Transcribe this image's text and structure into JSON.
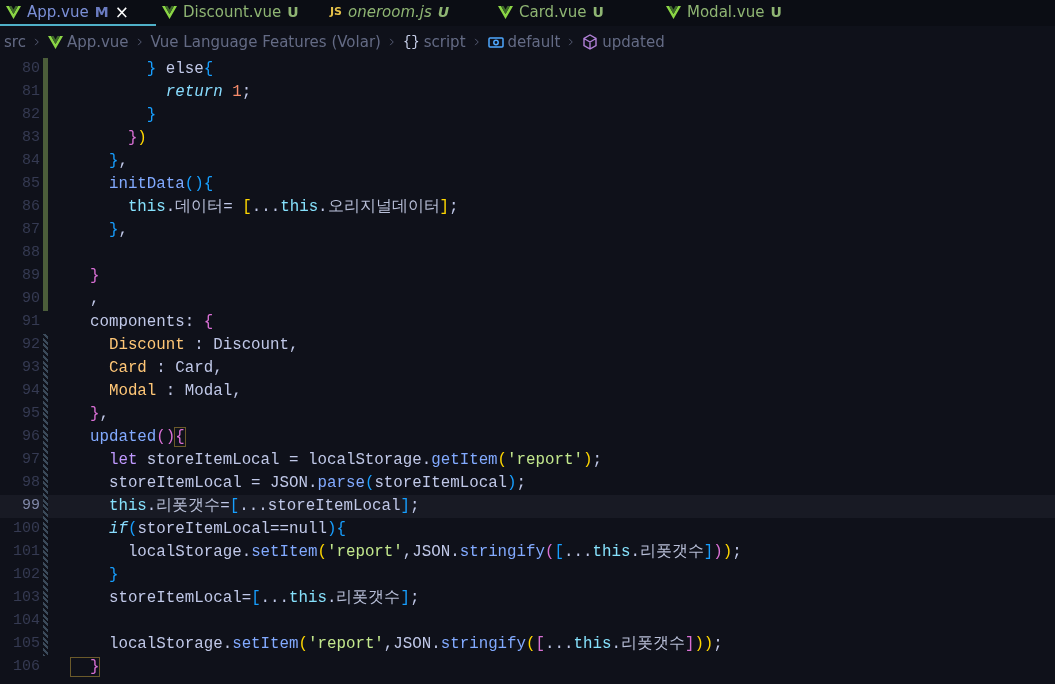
{
  "tabs": [
    {
      "label": "App.vue",
      "kind": "vue",
      "badge": "M",
      "selected": true,
      "italic": false,
      "close": "×"
    },
    {
      "label": "Discount.vue",
      "kind": "vue",
      "badge": "U",
      "selected": false,
      "italic": false
    },
    {
      "label": "oneroom.js",
      "kind": "js",
      "icon_label": "JS",
      "badge": "U",
      "selected": false,
      "italic": true
    },
    {
      "label": "Card.vue",
      "kind": "vue",
      "badge": "U",
      "selected": false,
      "italic": false
    },
    {
      "label": "Modal.vue",
      "kind": "vue",
      "badge": "U",
      "selected": false,
      "italic": false
    }
  ],
  "breadcrumb": [
    {
      "label": "src",
      "kind": "folder"
    },
    {
      "label": "App.vue",
      "kind": "vue"
    },
    {
      "label": "Vue Language Features (Volar)",
      "kind": "text"
    },
    {
      "label": "script",
      "kind": "braces",
      "glyph": "{}"
    },
    {
      "label": "default",
      "kind": "module"
    },
    {
      "label": "updated",
      "kind": "method"
    }
  ],
  "editor": {
    "lines": [
      {
        "number": "80",
        "modified": true,
        "added": false,
        "current": false,
        "tokens": [
          {
            "kind": "b3",
            "text": "        }"
          },
          {
            "kind": "p",
            "text": " else"
          },
          {
            "kind": "b3",
            "text": "{"
          }
        ]
      },
      {
        "number": "81",
        "modified": true,
        "added": false,
        "current": false,
        "tokens": [
          {
            "kind": "k",
            "text": "          return "
          },
          {
            "kind": "n",
            "text": "1"
          },
          {
            "kind": "p",
            "text": ";"
          }
        ]
      },
      {
        "number": "82",
        "modified": true,
        "added": false,
        "current": false,
        "tokens": [
          {
            "kind": "b3",
            "text": "        }"
          }
        ]
      },
      {
        "number": "83",
        "modified": true,
        "added": false,
        "current": false,
        "tokens": [
          {
            "kind": "b2",
            "text": "      }"
          },
          {
            "kind": "b1",
            "text": ")"
          }
        ]
      },
      {
        "number": "84",
        "modified": true,
        "added": false,
        "current": false,
        "tokens": [
          {
            "kind": "b3",
            "text": "    }"
          },
          {
            "kind": "p",
            "text": ","
          }
        ]
      },
      {
        "number": "85",
        "modified": true,
        "added": false,
        "current": false,
        "tokens": [
          {
            "kind": "f",
            "text": "    initData"
          },
          {
            "kind": "b3",
            "text": "(){"
          }
        ]
      },
      {
        "number": "86",
        "modified": true,
        "added": false,
        "current": false,
        "tokens": [
          {
            "kind": "t",
            "text": "      this"
          },
          {
            "kind": "p",
            "text": "."
          },
          {
            "kind": "h",
            "text": "데이터"
          },
          {
            "kind": "p",
            "text": "= "
          },
          {
            "kind": "b1",
            "text": "["
          },
          {
            "kind": "p",
            "text": "..."
          },
          {
            "kind": "t",
            "text": "this"
          },
          {
            "kind": "p",
            "text": "."
          },
          {
            "kind": "h",
            "text": "오리지널데이터"
          },
          {
            "kind": "b1",
            "text": "]"
          },
          {
            "kind": "p",
            "text": ";"
          }
        ]
      },
      {
        "number": "87",
        "modified": true,
        "added": false,
        "current": false,
        "tokens": [
          {
            "kind": "b3",
            "text": "    }"
          },
          {
            "kind": "p",
            "text": ","
          }
        ]
      },
      {
        "number": "88",
        "modified": true,
        "added": false,
        "current": false
      },
      {
        "number": "89",
        "modified": true,
        "added": false,
        "current": false,
        "tokens": [
          {
            "kind": "b2",
            "text": "  }"
          }
        ]
      },
      {
        "number": "90",
        "modified": true,
        "added": false,
        "current": false,
        "tokens": [
          {
            "kind": "p",
            "text": "  ,"
          }
        ]
      },
      {
        "number": "91",
        "modified": false,
        "added": false,
        "current": false,
        "tokens": [
          {
            "kind": "p",
            "text": "  components: "
          },
          {
            "kind": "b2",
            "text": "{"
          }
        ]
      },
      {
        "number": "92",
        "modified": false,
        "added": true,
        "current": false,
        "tokens": [
          {
            "kind": "y",
            "text": "    Discount"
          },
          {
            "kind": "p",
            "text": " : Discount,"
          }
        ]
      },
      {
        "number": "93",
        "modified": false,
        "added": true,
        "current": false,
        "tokens": [
          {
            "kind": "y",
            "text": "    Card"
          },
          {
            "kind": "p",
            "text": " : Card,"
          }
        ]
      },
      {
        "number": "94",
        "modified": false,
        "added": true,
        "current": false,
        "tokens": [
          {
            "kind": "y",
            "text": "    Modal"
          },
          {
            "kind": "p",
            "text": " : Modal,"
          }
        ]
      },
      {
        "number": "95",
        "modified": false,
        "added": true,
        "current": false,
        "tokens": [
          {
            "kind": "b2",
            "text": "  }"
          },
          {
            "kind": "p",
            "text": ","
          }
        ]
      },
      {
        "number": "96",
        "modified": false,
        "added": true,
        "current": false,
        "tokens": [
          {
            "kind": "f",
            "text": "  updated"
          },
          {
            "kind": "b2",
            "text": "()"
          },
          {
            "kind": "m2",
            "text": "{"
          }
        ]
      },
      {
        "number": "97",
        "modified": false,
        "added": true,
        "current": false,
        "tokens": [
          {
            "kind": "l",
            "text": "    let"
          },
          {
            "kind": "p",
            "text": " storeItemLocal = localStorage."
          },
          {
            "kind": "f",
            "text": "getItem"
          },
          {
            "kind": "b1",
            "text": "("
          },
          {
            "kind": "s",
            "text": "'report'"
          },
          {
            "kind": "b1",
            "text": ")"
          },
          {
            "kind": "p",
            "text": ";"
          }
        ]
      },
      {
        "number": "98",
        "modified": false,
        "added": true,
        "current": false,
        "tokens": [
          {
            "kind": "p",
            "text": "    storeItemLocal = JSON."
          },
          {
            "kind": "f",
            "text": "parse"
          },
          {
            "kind": "b3",
            "text": "("
          },
          {
            "kind": "p",
            "text": "storeItemLocal"
          },
          {
            "kind": "b3",
            "text": ")"
          },
          {
            "kind": "p",
            "text": ";"
          }
        ]
      },
      {
        "number": "99",
        "modified": false,
        "added": true,
        "current": true,
        "tokens": [
          {
            "kind": "t",
            "text": "    this"
          },
          {
            "kind": "p",
            "text": "."
          },
          {
            "kind": "h",
            "text": "리폿갯수"
          },
          {
            "kind": "p",
            "text": "="
          },
          {
            "kind": "b3",
            "text": "["
          },
          {
            "kind": "p",
            "text": "...storeItemLocal"
          },
          {
            "kind": "b3",
            "text": "]"
          },
          {
            "kind": "p",
            "text": ";"
          }
        ]
      },
      {
        "number": "100",
        "modified": false,
        "added": true,
        "current": false,
        "tokens": [
          {
            "kind": "k",
            "text": "    if"
          },
          {
            "kind": "b3",
            "text": "("
          },
          {
            "kind": "p",
            "text": "storeItemLocal==null"
          },
          {
            "kind": "b3",
            "text": "){"
          }
        ]
      },
      {
        "number": "101",
        "modified": false,
        "added": true,
        "current": false,
        "tokens": [
          {
            "kind": "p",
            "text": "      localStorage."
          },
          {
            "kind": "f",
            "text": "setItem"
          },
          {
            "kind": "b1",
            "text": "("
          },
          {
            "kind": "s",
            "text": "'report'"
          },
          {
            "kind": "p",
            "text": ",JSON."
          },
          {
            "kind": "f",
            "text": "stringify"
          },
          {
            "kind": "b2",
            "text": "("
          },
          {
            "kind": "b3",
            "text": "["
          },
          {
            "kind": "p",
            "text": "..."
          },
          {
            "kind": "t",
            "text": "this"
          },
          {
            "kind": "p",
            "text": "."
          },
          {
            "kind": "h",
            "text": "리폿갯수"
          },
          {
            "kind": "b3",
            "text": "]"
          },
          {
            "kind": "b2",
            "text": ")"
          },
          {
            "kind": "b1",
            "text": ")"
          },
          {
            "kind": "p",
            "text": ";"
          }
        ]
      },
      {
        "number": "102",
        "modified": false,
        "added": true,
        "current": false,
        "tokens": [
          {
            "kind": "b3",
            "text": "    }"
          }
        ]
      },
      {
        "number": "103",
        "modified": false,
        "added": true,
        "current": false,
        "tokens": [
          {
            "kind": "p",
            "text": "    storeItemLocal="
          },
          {
            "kind": "b3",
            "text": "["
          },
          {
            "kind": "p",
            "text": "..."
          },
          {
            "kind": "t",
            "text": "this"
          },
          {
            "kind": "p",
            "text": "."
          },
          {
            "kind": "h",
            "text": "리폿갯수"
          },
          {
            "kind": "b3",
            "text": "]"
          },
          {
            "kind": "p",
            "text": ";"
          }
        ]
      },
      {
        "number": "104",
        "modified": false,
        "added": true,
        "current": false
      },
      {
        "number": "105",
        "modified": false,
        "added": true,
        "current": false,
        "tokens": [
          {
            "kind": "p",
            "text": "    localStorage."
          },
          {
            "kind": "f",
            "text": "setItem"
          },
          {
            "kind": "b1",
            "text": "("
          },
          {
            "kind": "s",
            "text": "'report'"
          },
          {
            "kind": "p",
            "text": ",JSON."
          },
          {
            "kind": "f",
            "text": "stringify"
          },
          {
            "kind": "b1",
            "text": "("
          },
          {
            "kind": "b2",
            "text": "["
          },
          {
            "kind": "p",
            "text": "..."
          },
          {
            "kind": "t",
            "text": "this"
          },
          {
            "kind": "p",
            "text": "."
          },
          {
            "kind": "h",
            "text": "리폿갯수"
          },
          {
            "kind": "b2",
            "text": "]"
          },
          {
            "kind": "b1",
            "text": "))"
          },
          {
            "kind": "p",
            "text": ";"
          }
        ]
      },
      {
        "number": "106",
        "modified": false,
        "added": false,
        "current": false,
        "tokens": [
          {
            "kind": "m2",
            "text": "  }"
          }
        ]
      }
    ]
  }
}
